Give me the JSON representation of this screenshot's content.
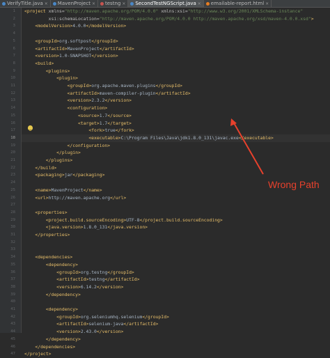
{
  "tabs": [
    {
      "label": "VerifyTitle.java",
      "icon_color": "#4a88c7",
      "active": false
    },
    {
      "label": "MavenProject",
      "icon_color": "#4a88c7",
      "active": false
    },
    {
      "label": "testng",
      "icon_color": "#c75450",
      "active": false
    },
    {
      "label": "SecondTestNGScript.java",
      "icon_color": "#4a88c7",
      "active": true
    },
    {
      "label": "emailable-report.html",
      "icon_color": "#e67d22",
      "active": false
    }
  ],
  "editor": {
    "current_line": 18,
    "lines": [
      [
        [
          "tag",
          "<project "
        ],
        [
          "attr",
          "xmlns="
        ],
        [
          "val",
          "\"http://maven.apache.org/POM/4.0.0\" "
        ],
        [
          "attr",
          "xmlns:xsi="
        ],
        [
          "val",
          "\"http://www.w3.org/2001/XMLSchema-instance\""
        ]
      ],
      [
        [
          "attr",
          "         xsi:schemaLocation="
        ],
        [
          "val",
          "\"http://maven.apache.org/POM/4.0.0 http://maven.apache.org/xsd/maven-4.0.0.xsd\""
        ],
        [
          "tag",
          ">"
        ]
      ],
      [
        [
          "tag",
          "    <modelVersion>"
        ],
        [
          "txtc",
          "4.0.0"
        ],
        [
          "tag",
          "</modelVersion>"
        ]
      ],
      [
        [
          "txtc",
          ""
        ]
      ],
      [
        [
          "tag",
          "    <groupId>"
        ],
        [
          "txtc",
          "org.softpost"
        ],
        [
          "tag",
          "</groupId>"
        ]
      ],
      [
        [
          "tag",
          "    <artifactId>"
        ],
        [
          "txtc",
          "MavenProject"
        ],
        [
          "tag",
          "</artifactId>"
        ]
      ],
      [
        [
          "tag",
          "    <version>"
        ],
        [
          "txtc",
          "1.0-SNAPSHOT"
        ],
        [
          "tag",
          "</version>"
        ]
      ],
      [
        [
          "tag",
          "    <build>"
        ]
      ],
      [
        [
          "tag",
          "        <plugins>"
        ]
      ],
      [
        [
          "tag",
          "            <plugin>"
        ]
      ],
      [
        [
          "tag",
          "                <groupId>"
        ],
        [
          "txtc",
          "org.apache.maven.plugins"
        ],
        [
          "tag",
          "</groupId>"
        ]
      ],
      [
        [
          "tag",
          "                <artifactId>"
        ],
        [
          "txtc",
          "maven-compiler-plugin"
        ],
        [
          "tag",
          "</artifactId>"
        ]
      ],
      [
        [
          "tag",
          "                <version>"
        ],
        [
          "txtc",
          "2.3.2"
        ],
        [
          "tag",
          "</version>"
        ]
      ],
      [
        [
          "tag",
          "                <configuration>"
        ]
      ],
      [
        [
          "tag",
          "                    <source>"
        ],
        [
          "txtc",
          "1.7"
        ],
        [
          "tag",
          "</source>"
        ]
      ],
      [
        [
          "tag",
          "                    <target>"
        ],
        [
          "txtc",
          "1.7"
        ],
        [
          "tag",
          "</target>"
        ]
      ],
      [
        [
          "tag",
          "                        <fork>"
        ],
        [
          "txtc",
          "true"
        ],
        [
          "tag",
          "</fork>"
        ]
      ],
      [
        [
          "tag",
          "                        <executable>"
        ],
        [
          "txtc",
          "C:\\Program Files\\Java\\jdk1.8.0_131\\javac.exe"
        ],
        [
          "tag",
          "</executable>"
        ]
      ],
      [
        [
          "tag",
          "                </configuration>"
        ]
      ],
      [
        [
          "tag",
          "            </plugin>"
        ]
      ],
      [
        [
          "tag",
          "        </plugins>"
        ]
      ],
      [
        [
          "tag",
          "    </build>"
        ]
      ],
      [
        [
          "tag",
          "    <packaging>"
        ],
        [
          "txtc",
          "jar"
        ],
        [
          "tag",
          "</packaging>"
        ]
      ],
      [
        [
          "txtc",
          ""
        ]
      ],
      [
        [
          "tag",
          "    <name>"
        ],
        [
          "txtc",
          "MavenProject"
        ],
        [
          "tag",
          "</name>"
        ]
      ],
      [
        [
          "tag",
          "    <url>"
        ],
        [
          "txtc",
          "http://maven.apache.org"
        ],
        [
          "tag",
          "</url>"
        ]
      ],
      [
        [
          "txtc",
          ""
        ]
      ],
      [
        [
          "tag",
          "    <properties>"
        ]
      ],
      [
        [
          "tag",
          "        <project.build.sourceEncoding>"
        ],
        [
          "txtc",
          "UTF-8"
        ],
        [
          "tag",
          "</project.build.sourceEncoding>"
        ]
      ],
      [
        [
          "tag",
          "        <java.version>"
        ],
        [
          "txtc",
          "1.8.0_131"
        ],
        [
          "tag",
          "</java.version>"
        ]
      ],
      [
        [
          "tag",
          "    </properties>"
        ]
      ],
      [
        [
          "txtc",
          ""
        ]
      ],
      [
        [
          "txtc",
          ""
        ]
      ],
      [
        [
          "tag",
          "    <dependencies>"
        ]
      ],
      [
        [
          "tag",
          "        <dependency>"
        ]
      ],
      [
        [
          "tag",
          "            <groupId>"
        ],
        [
          "txtc",
          "org.testng"
        ],
        [
          "tag",
          "</groupId>"
        ]
      ],
      [
        [
          "tag",
          "            <artifactId>"
        ],
        [
          "txtc",
          "testng"
        ],
        [
          "tag",
          "</artifactId>"
        ]
      ],
      [
        [
          "tag",
          "            <version>"
        ],
        [
          "txtc",
          "6.14.2"
        ],
        [
          "tag",
          "</version>"
        ]
      ],
      [
        [
          "tag",
          "        </dependency>"
        ]
      ],
      [
        [
          "txtc",
          ""
        ]
      ],
      [
        [
          "tag",
          "        <dependency>"
        ]
      ],
      [
        [
          "tag",
          "            <groupId>"
        ],
        [
          "txtc",
          "org.seleniumhq.selenium"
        ],
        [
          "tag",
          "</groupId>"
        ]
      ],
      [
        [
          "tag",
          "            <artifactId>"
        ],
        [
          "txtc",
          "selenium-java"
        ],
        [
          "tag",
          "</artifactId>"
        ]
      ],
      [
        [
          "tag",
          "            <version>"
        ],
        [
          "txtc",
          "2.43.0"
        ],
        [
          "tag",
          "</version>"
        ]
      ],
      [
        [
          "tag",
          "        </dependency>"
        ]
      ],
      [
        [
          "tag",
          "    </dependencies>"
        ]
      ],
      [
        [
          "tag",
          "</project>"
        ]
      ]
    ]
  },
  "annotation": {
    "label": "Wrong Path",
    "color": "#e8412c"
  }
}
